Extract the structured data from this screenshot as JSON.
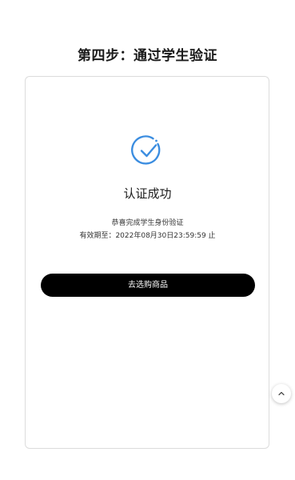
{
  "header": {
    "step_title": "第四步：通过学生验证"
  },
  "result": {
    "icon": "check-circle-icon",
    "title": "认证成功",
    "message": "恭喜完成学生身份验证",
    "validity": "有效期至：2022年08月30日23:59:59 止"
  },
  "actions": {
    "go_shopping_label": "去选购商品"
  },
  "floating": {
    "back_to_top_icon": "chevron-up-icon"
  },
  "colors": {
    "accent": "#3b8de0",
    "button_bg": "#000000",
    "button_text": "#ffffff"
  }
}
